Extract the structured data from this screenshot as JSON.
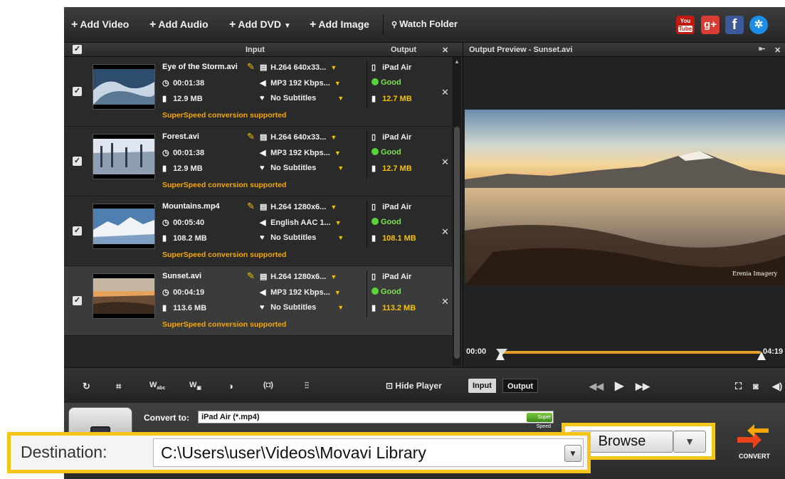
{
  "toolbar": {
    "add_video": "Add Video",
    "add_audio": "Add Audio",
    "add_dvd": "Add DVD",
    "add_image": "Add Image",
    "watch_folder": "Watch Folder",
    "social": {
      "youtube_top": "You",
      "youtube_bottom": "Tube",
      "gplus": "g+",
      "facebook": "f"
    }
  },
  "list": {
    "header_input": "Input",
    "header_output": "Output",
    "close": "✕",
    "superspeed_text": "SuperSpeed conversion supported",
    "items": [
      {
        "name": "Eye of the Storm.avi",
        "duration": "00:01:38",
        "size": "12.9 MB",
        "video": "H.264 640x33...",
        "audio": "MP3 192 Kbps...",
        "subtitles": "No Subtitles",
        "device": "iPad Air",
        "quality": "Good",
        "out_size": "12.7 MB"
      },
      {
        "name": "Forest.avi",
        "duration": "00:01:38",
        "size": "12.9 MB",
        "video": "H.264 640x33...",
        "audio": "MP3 192 Kbps...",
        "subtitles": "No Subtitles",
        "device": "iPad Air",
        "quality": "Good",
        "out_size": "12.7 MB"
      },
      {
        "name": "Mountains.mp4",
        "duration": "00:05:40",
        "size": "108.2 MB",
        "video": "H.264 1280x6...",
        "audio": "English AAC 1...",
        "subtitles": "No Subtitles",
        "device": "iPad Air",
        "quality": "Good",
        "out_size": "108.1 MB"
      },
      {
        "name": "Sunset.avi",
        "duration": "00:04:19",
        "size": "113.6 MB",
        "video": "H.264 1280x6...",
        "audio": "MP3 192 Kbps...",
        "subtitles": "No Subtitles",
        "device": "iPad Air",
        "quality": "Good",
        "out_size": "113.2 MB"
      }
    ]
  },
  "preview": {
    "title": "Output Preview - Sunset.avi",
    "watermark": "Erenia Imagery",
    "time_start": "00:00",
    "time_end": "04:19"
  },
  "tools": {
    "hide_player": "Hide Player",
    "input_tab": "Input",
    "output_tab": "Output"
  },
  "convert": {
    "convert_to_label": "Convert to:",
    "convert_to_value": "iPad Air (*.mp4)",
    "superspeed_badge": "Super Speed",
    "browse": "Browse",
    "destination_label": "Destination:",
    "destination_value": "C:\\Users\\user\\Videos\\Movavi Library",
    "convert_button": "CONVERT"
  },
  "colors": {
    "highlight": "#f5c518",
    "superspeed": "#f5a800",
    "good": "#5bd43b"
  }
}
